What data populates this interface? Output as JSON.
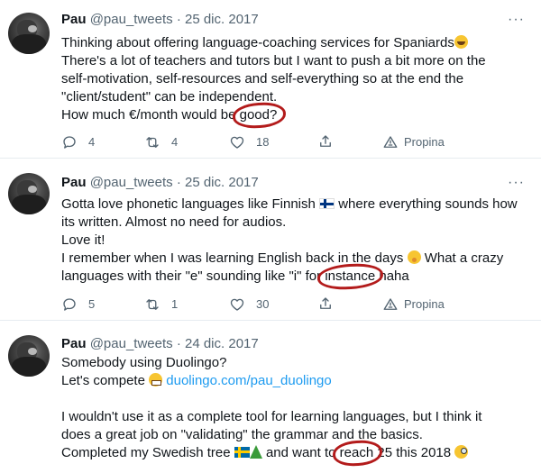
{
  "tweets": [
    {
      "name": "Pau",
      "handle": "@pau_tweets",
      "separator": "·",
      "date": "25 dic. 2017",
      "lines": [
        "Thinking about offering language-coaching services for Spaniards",
        "There's a lot of teachers and tutors but I want to push a bit more on the",
        "self-motivation, self-resources and self-everything so at the end the",
        "\"client/student\" can be independent.",
        "How much €/month would be",
        "good?"
      ],
      "emoji": "grinning-face",
      "replies": "4",
      "retweets": "4",
      "likes": "18",
      "tip_label": "Propina"
    },
    {
      "name": "Pau",
      "handle": "@pau_tweets",
      "separator": "·",
      "date": "25 dic. 2017",
      "lines": [
        "Gotta love phonetic languages like Finnish",
        "where everything sounds how",
        "its written. Almost no need for audios.",
        "Love it!",
        "I remember when I was learning English back in the days",
        "What a crazy",
        "languages with their \"e\" sounding like \"i\" for",
        "instance",
        "haha"
      ],
      "flag": "finland-flag",
      "emoji": "shushing-face",
      "replies": "5",
      "retweets": "1",
      "likes": "30",
      "tip_label": "Propina"
    },
    {
      "name": "Pau",
      "handle": "@pau_tweets",
      "separator": "·",
      "date": "24 dic. 2017",
      "lines": [
        "Somebody using Duolingo?",
        "Let's compete",
        "duolingo.com/pau_duolingo",
        "I wouldn't use it as a complete tool for learning languages, but I think it",
        "does a great job on \"validating\" the grammar and the basics.",
        "Completed my Swedish tree",
        "and want to",
        "reach",
        "25 this 2018"
      ],
      "emoji": [
        "grimacing-face",
        "sweden-flag",
        "christmas-tree",
        "face-with-monocle"
      ]
    }
  ],
  "colors": {
    "accent": "#1d9bf0",
    "muted": "#536471",
    "annotation": "#b31b1b"
  }
}
